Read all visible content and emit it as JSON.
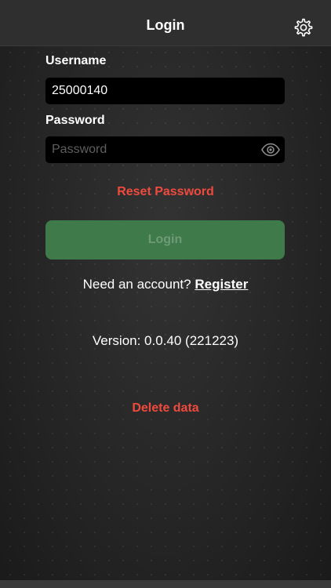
{
  "header": {
    "title": "Login",
    "settings_icon": "gear-icon"
  },
  "form": {
    "username_label": "Username",
    "username_value": "25000140",
    "password_label": "Password",
    "password_placeholder": "Password",
    "password_value": "",
    "show_password_icon": "eye-icon",
    "reset_password_label": "Reset Password",
    "login_label": "Login"
  },
  "register": {
    "prompt": "Need an account?",
    "link_label": "Register"
  },
  "version_text": "Version: 0.0.40 (221223)",
  "delete_label": "Delete data",
  "colors": {
    "accent_red": "#ee4a3e",
    "login_button": "#3f7a4a",
    "field_background": "#000000"
  }
}
